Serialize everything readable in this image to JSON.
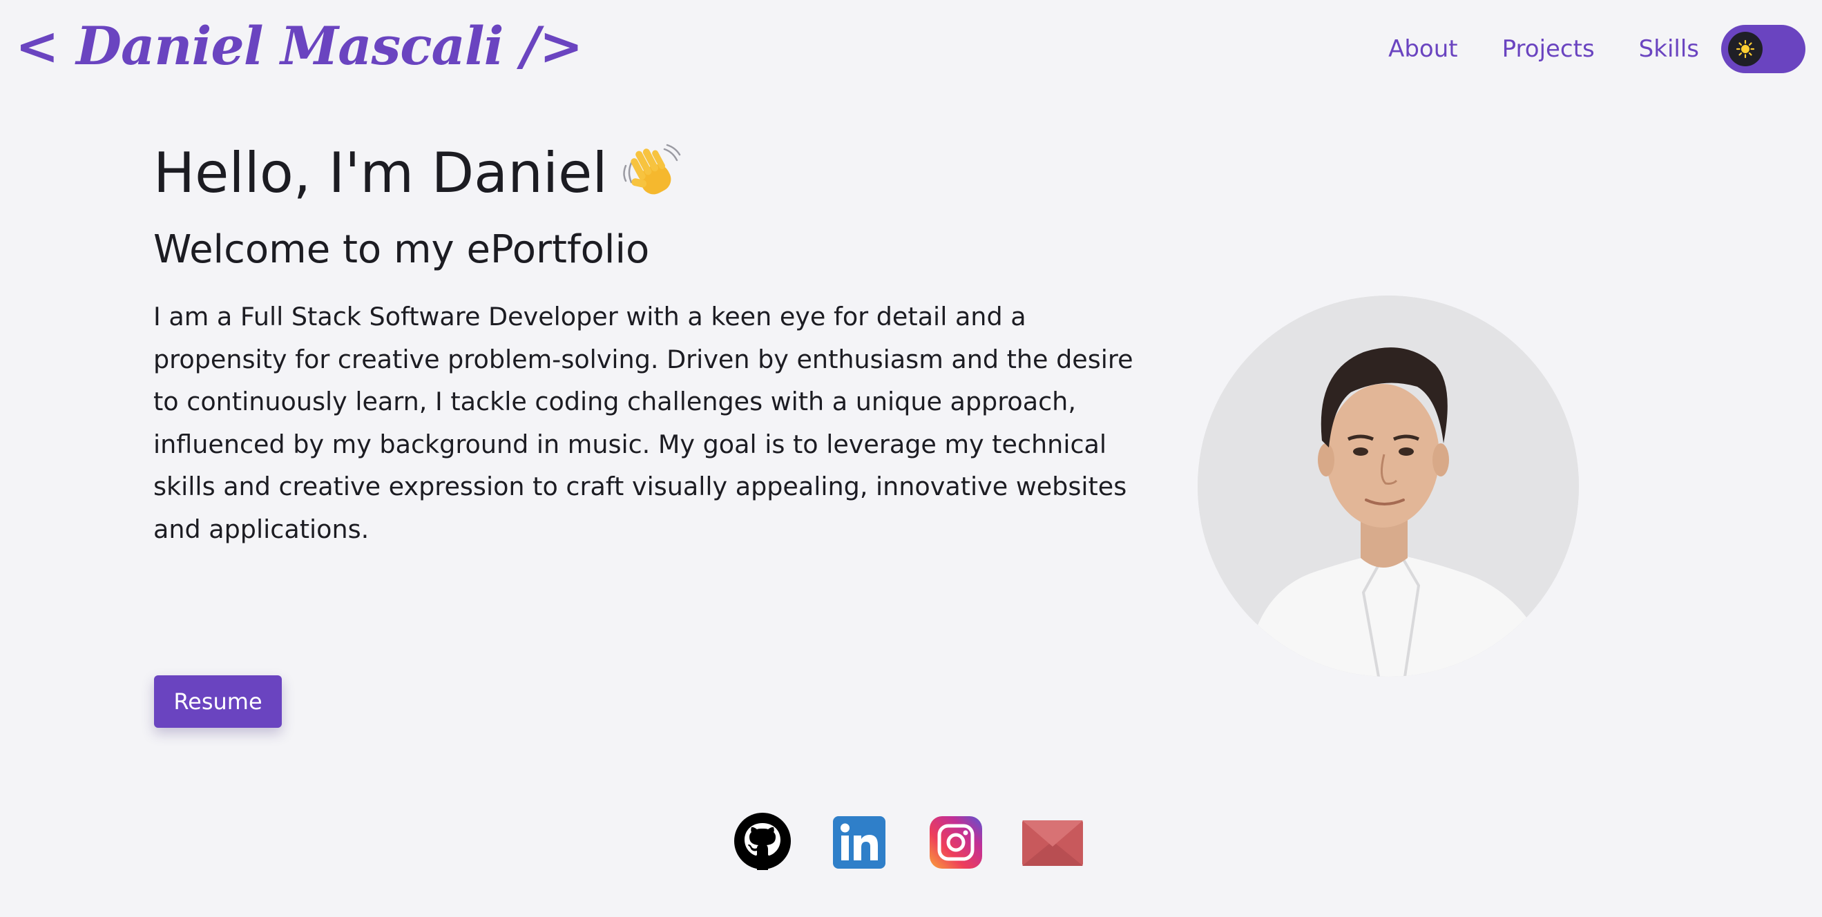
{
  "header": {
    "logo_text": "< Daniel Mascali />",
    "nav": [
      {
        "label": "About"
      },
      {
        "label": "Projects"
      },
      {
        "label": "Skills"
      }
    ],
    "theme_toggle": {
      "icon": "sun-icon",
      "state": "light"
    }
  },
  "hero": {
    "greeting": "Hello, I'm Daniel",
    "greeting_icon": "waving-hand-icon",
    "subtitle": "Welcome to my ePortfolio",
    "bio": "I am a Full Stack Software Developer with a keen eye for detail and a propensity for creative problem-solving. Driven by enthusiasm and the desire to continuously learn, I tackle coding challenges with a unique approach, influenced by my background in music. My goal is to leverage my technical skills and creative expression to craft visually appealing, innovative websites and applications.",
    "resume_label": "Resume"
  },
  "social": [
    {
      "icon": "github-icon"
    },
    {
      "icon": "linkedin-icon"
    },
    {
      "icon": "instagram-icon"
    },
    {
      "icon": "email-icon"
    }
  ],
  "colors": {
    "accent": "#6a44c0",
    "background": "#f4f4f7",
    "text": "#1c1c22"
  }
}
